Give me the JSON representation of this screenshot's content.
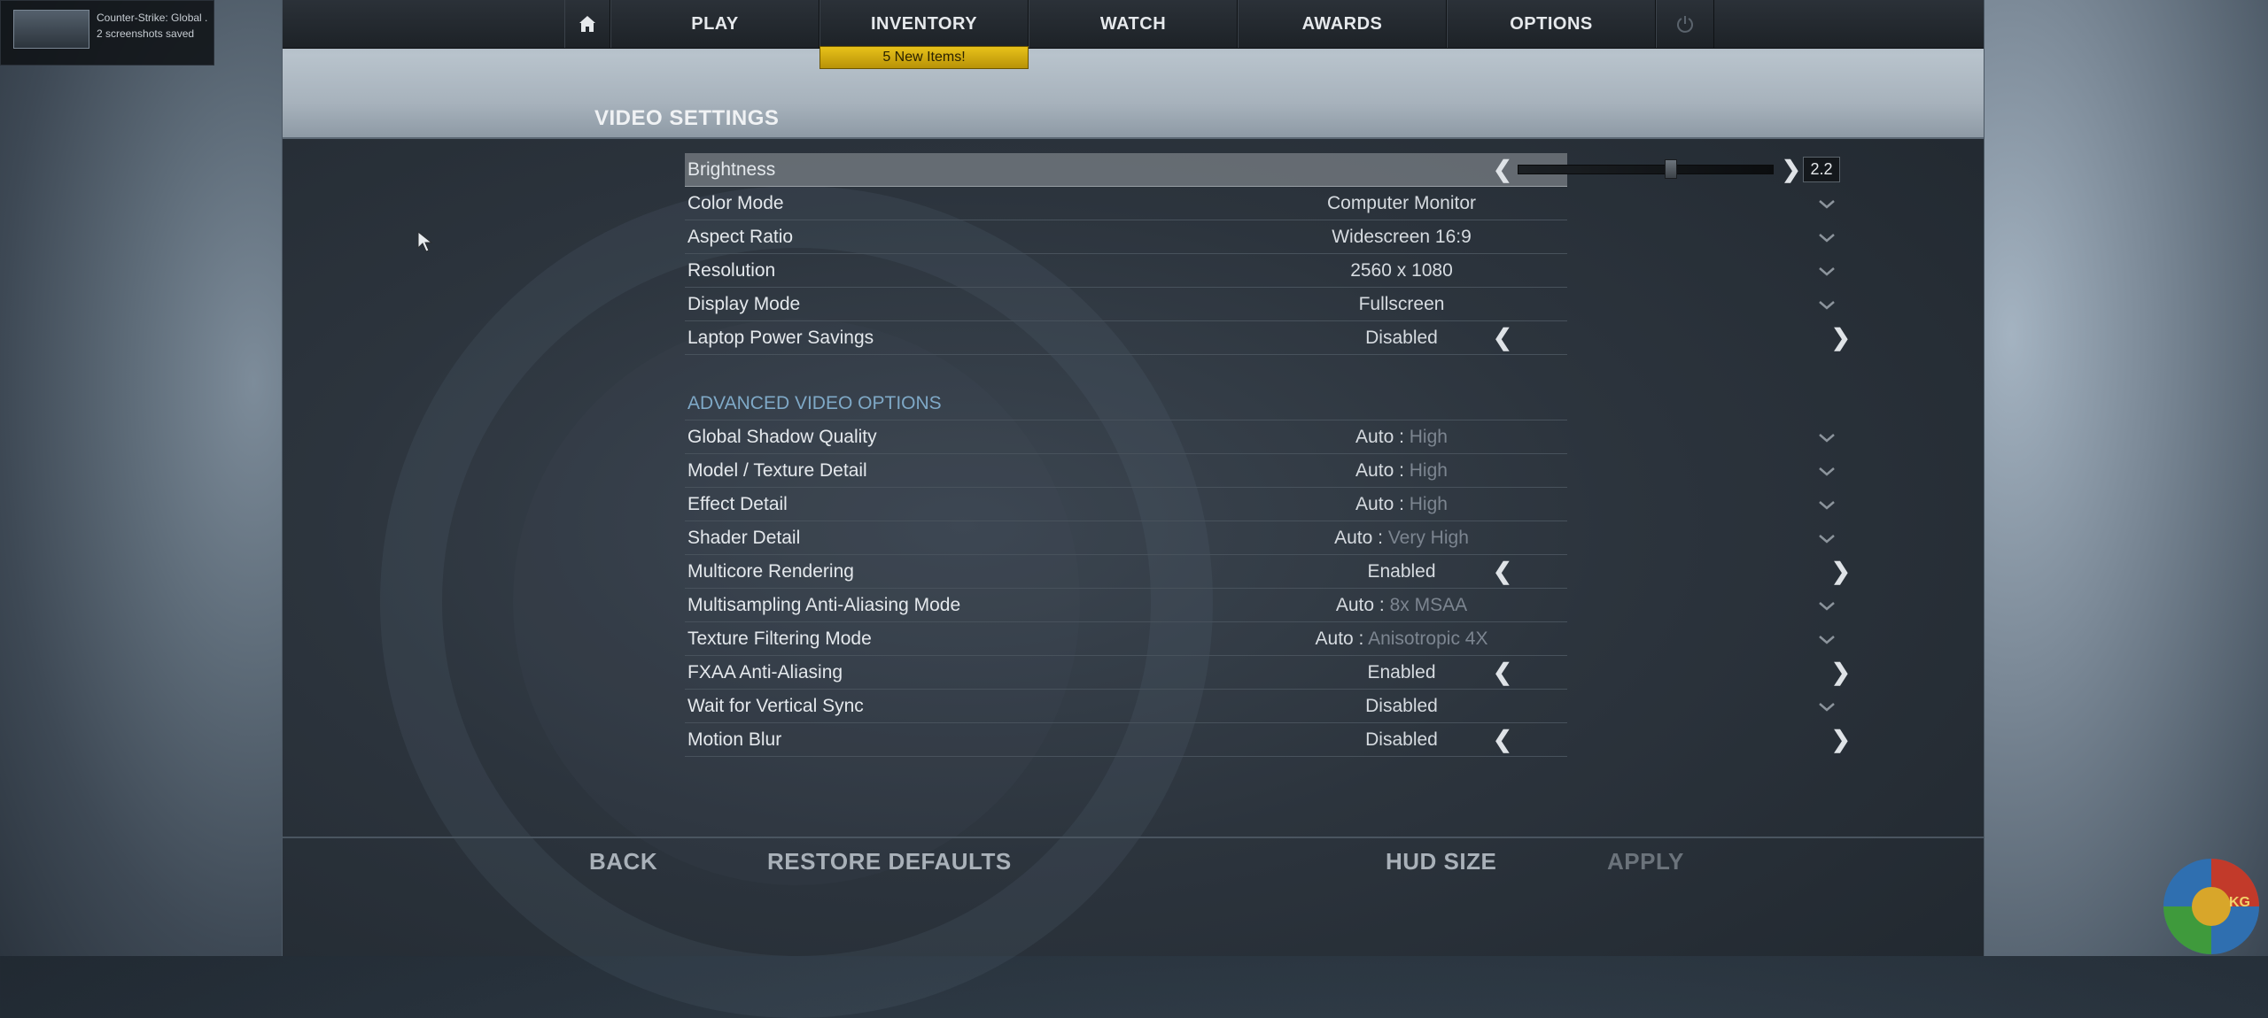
{
  "notification": {
    "title": "Counter-Strike: Global ...",
    "subtitle": "2 screenshots saved"
  },
  "nav": {
    "home_icon": "home-icon",
    "items": [
      {
        "label": "PLAY"
      },
      {
        "label": "INVENTORY"
      },
      {
        "label": "WATCH"
      },
      {
        "label": "AWARDS"
      },
      {
        "label": "OPTIONS"
      }
    ],
    "badge": "5 New Items!",
    "power_icon": "power-icon"
  },
  "page_title": "VIDEO SETTINGS",
  "brightness": {
    "label": "Brightness",
    "value": "2.2",
    "slider_fraction": 0.6
  },
  "basic_settings": [
    {
      "label": "Color Mode",
      "value": "Computer Monitor",
      "control": "dropdown"
    },
    {
      "label": "Aspect Ratio",
      "value": "Widescreen 16:9",
      "control": "dropdown"
    },
    {
      "label": "Resolution",
      "value": "2560 x 1080",
      "control": "dropdown"
    },
    {
      "label": "Display Mode",
      "value": "Fullscreen",
      "control": "dropdown"
    },
    {
      "label": "Laptop Power Savings",
      "value": "Disabled",
      "control": "arrows"
    }
  ],
  "advanced_title": "ADVANCED VIDEO OPTIONS",
  "advanced_settings": [
    {
      "label": "Global Shadow Quality",
      "prefix": "Auto : ",
      "value": "High",
      "control": "dropdown"
    },
    {
      "label": "Model / Texture Detail",
      "prefix": "Auto : ",
      "value": "High",
      "control": "dropdown"
    },
    {
      "label": "Effect Detail",
      "prefix": "Auto : ",
      "value": "High",
      "control": "dropdown"
    },
    {
      "label": "Shader Detail",
      "prefix": "Auto : ",
      "value": "Very High",
      "control": "dropdown"
    },
    {
      "label": "Multicore Rendering",
      "prefix": "",
      "value": "Enabled",
      "control": "arrows"
    },
    {
      "label": "Multisampling Anti-Aliasing Mode",
      "prefix": "Auto : ",
      "value": "8x MSAA",
      "control": "dropdown"
    },
    {
      "label": "Texture Filtering Mode",
      "prefix": "Auto : ",
      "value": "Anisotropic 4X",
      "control": "dropdown"
    },
    {
      "label": "FXAA Anti-Aliasing",
      "prefix": "",
      "value": "Enabled",
      "control": "arrows"
    },
    {
      "label": "Wait for Vertical Sync",
      "prefix": "",
      "value": "Disabled",
      "control": "dropdown"
    },
    {
      "label": "Motion Blur",
      "prefix": "",
      "value": "Disabled",
      "control": "arrows"
    }
  ],
  "footer": {
    "back": "BACK",
    "restore": "RESTORE DEFAULTS",
    "hud": "HUD SIZE",
    "apply": "APPLY"
  },
  "logo_text": "KG",
  "colors": {
    "badge": "#e8c21a",
    "advanced_title": "#7fa9c7",
    "dim_value": "#7c8590"
  }
}
